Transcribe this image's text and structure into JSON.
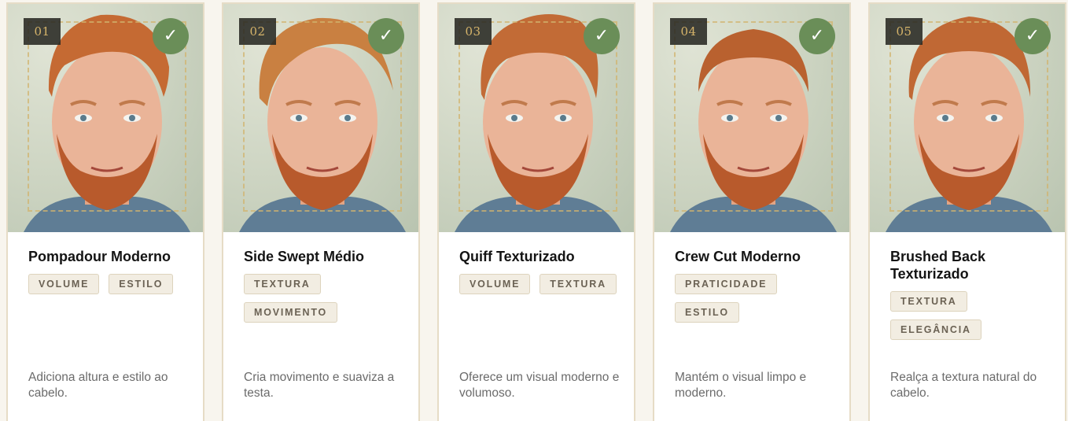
{
  "cards": [
    {
      "number": "01",
      "title": "Pompadour Moderno",
      "tags": [
        "VOLUME",
        "ESTILO"
      ],
      "description": "Adiciona altura e estilo ao cabelo.",
      "selected_icon": "check-icon",
      "check_symbol": "✓"
    },
    {
      "number": "02",
      "title": "Side Swept Médio",
      "tags": [
        "TEXTURA",
        "MOVIMENTO"
      ],
      "description": "Cria movimento e suaviza a testa.",
      "selected_icon": "check-icon",
      "check_symbol": "✓"
    },
    {
      "number": "03",
      "title": "Quiff Texturizado",
      "tags": [
        "VOLUME",
        "TEXTURA"
      ],
      "description": "Oferece um visual moderno e volumoso.",
      "selected_icon": "check-icon",
      "check_symbol": "✓"
    },
    {
      "number": "04",
      "title": "Crew Cut Moderno",
      "tags": [
        "PRATICIDADE",
        "ESTILO"
      ],
      "description": "Mantém o visual limpo e moderno.",
      "selected_icon": "check-icon",
      "check_symbol": "✓"
    },
    {
      "number": "05",
      "title": "Brushed Back Texturizado",
      "tags": [
        "TEXTURA",
        "ELEGÂNCIA"
      ],
      "description": "Realça a textura natural do cabelo.",
      "selected_icon": "check-icon",
      "check_symbol": "✓"
    }
  ],
  "colors": {
    "accent_green": "#6a8e58",
    "number_gold": "#d6b46a",
    "card_border": "#e6dcc6",
    "tag_bg": "#f2ede2"
  }
}
